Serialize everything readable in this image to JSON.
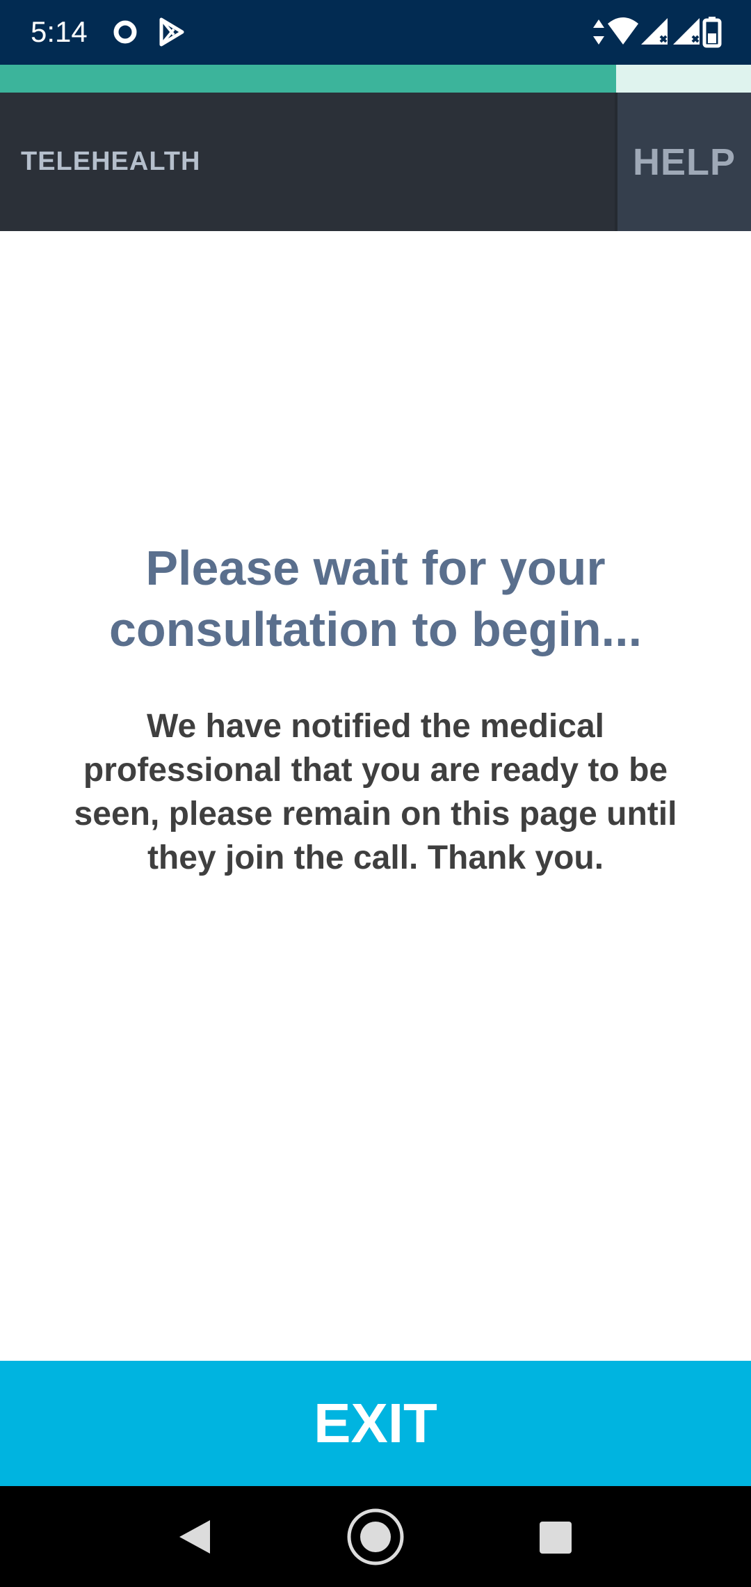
{
  "status_bar": {
    "time": "5:14",
    "left_icons": [
      "record-circle-icon",
      "play-store-icon"
    ],
    "right_icons": [
      "data-arrows-icon",
      "wifi-icon",
      "signal-icon",
      "signal-icon",
      "battery-icon"
    ]
  },
  "progress": {
    "fraction": 0.82,
    "fill_color": "#3cb49b",
    "track_color": "#dff3ee"
  },
  "header": {
    "brand": "TELEHEALTH",
    "help_label": "HELP"
  },
  "main": {
    "heading": "Please wait for your consultation to begin...",
    "message": "We have notified the medical professional that you are ready to be seen, please remain on this page until they join the call. Thank you."
  },
  "footer": {
    "exit_label": "EXIT",
    "exit_color": "#00b4e0"
  },
  "nav_bar": {
    "icons": [
      "back-icon",
      "home-icon",
      "recents-icon"
    ]
  }
}
